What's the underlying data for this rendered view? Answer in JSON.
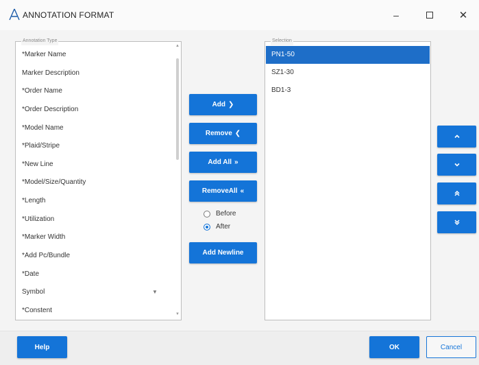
{
  "window": {
    "title": "ANNOTATION FORMAT",
    "minimize": "–",
    "close": "✕"
  },
  "annotation_type": {
    "legend": "Annotation Type",
    "items": [
      "*Marker Name",
      "Marker Description",
      "*Order Name",
      "*Order Description",
      "*Model Name",
      "*Plaid/Stripe",
      "*New Line",
      "*Model/Size/Quantity",
      "*Length",
      "*Utilization",
      "*Marker Width",
      "*Add Pc/Bundle",
      "*Date",
      "Symbol",
      "*Constent"
    ],
    "dropdown_glyph": "▼"
  },
  "selection": {
    "legend": "Selection",
    "items": [
      "PN1-50",
      "SZ1-30",
      "BD1-3"
    ],
    "selected_index": 0
  },
  "actions": {
    "add": "Add",
    "add_chev": "❯",
    "remove": "Remove",
    "remove_chev": "❮",
    "add_all": "Add All",
    "add_all_chev": "»",
    "remove_all": "RemoveAll",
    "remove_all_chev": "«",
    "add_newline": "Add Newline"
  },
  "position": {
    "before": "Before",
    "after": "After",
    "selected": "after"
  },
  "footer": {
    "help": "Help",
    "ok": "OK",
    "cancel": "Cancel"
  },
  "colors": {
    "accent": "#1474d8",
    "selected_row": "#1e6ec8"
  }
}
